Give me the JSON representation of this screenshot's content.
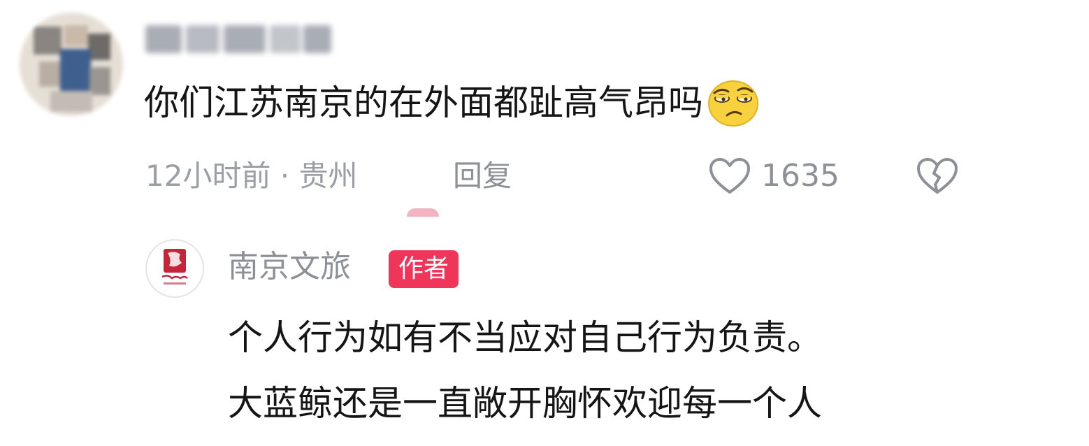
{
  "comment": {
    "text": "你们江苏南京的在外面都趾高气昂吗",
    "emoji_icon": "skeptical-face-emoji",
    "time_location": "12小时前 · 贵州",
    "reply_label": "回复",
    "like_count": "1635",
    "icons": [
      "heart-outline-icon",
      "broken-heart-icon"
    ]
  },
  "author_reply": {
    "author_name": "南京文旅",
    "badge": "作者",
    "lines": [
      "个人行为如有不当应对自己行为负责。",
      "大蓝鲸还是一直敞开胸怀欢迎每一个人"
    ]
  },
  "colors": {
    "badge": "#f0355a",
    "meta_text": "#9b9ea4",
    "body_text": "#151515",
    "emoji_face": "#f7d23e"
  }
}
